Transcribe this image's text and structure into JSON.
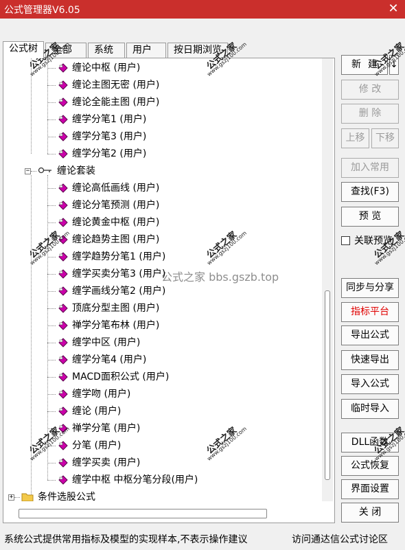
{
  "window": {
    "title": "公式管理器V6.05",
    "close_icon": "close-icon"
  },
  "tabs": [
    {
      "label": "公式树",
      "active": true
    },
    {
      "label": "全部",
      "active": false
    },
    {
      "label": "系统",
      "active": false
    },
    {
      "label": "用户",
      "active": false
    },
    {
      "label": "按日期浏览",
      "active": false
    }
  ],
  "tree": {
    "group1_items": [
      "缠论中枢 (用户)",
      "缠论主图无密 (用户)",
      "缠论全能主图 (用户)",
      "缠学分笔1 (用户)",
      "缠学分笔3 (用户)",
      "缠学分笔2 (用户)"
    ],
    "group2_label": "缠论套装",
    "group2_items": [
      "缠论高低画线 (用户)",
      "缠论分笔预测 (用户)",
      "缠论黄金中枢 (用户)",
      "缠论趋势主图 (用户)",
      "缠学趋势分笔1 (用户)",
      "缠学买卖分笔3 (用户)",
      "缠学画线分笔2 (用户)",
      "顶底分型主图 (用户)",
      "禅学分笔布林 (用户)",
      "缠学中区 (用户)",
      "缠学分笔4 (用户)",
      "MACD面积公式 (用户)",
      "缠学吻 (用户)",
      "缠论 (用户)",
      "禅学分笔 (用户)",
      "分笔 (用户)",
      "缠学买卖 (用户)",
      "缠学中枢  中枢分笔分段(用户)"
    ],
    "folder_label": "条件选股公式"
  },
  "buttons": {
    "new": "新建",
    "new_arrow": "↓",
    "modify": "修 改",
    "delete": "删 除",
    "move_up": "上移",
    "move_down": "下移",
    "add_common": "加入常用",
    "find": "查找(F3)",
    "preview": "预 览",
    "linked_preview": "关联预览",
    "sync_share": "同步与分享",
    "indicator_platform": "指标平台",
    "export_formula": "导出公式",
    "quick_export": "快速导出",
    "import_formula": "导入公式",
    "temp_import": "临时导入",
    "dll_func": "DLL函数",
    "formula_restore": "公式恢复",
    "ui_settings": "界面设置",
    "close": "关 闭"
  },
  "status": {
    "left": "系统公式提供常用指标及模型的实现样本,不表示操作建议",
    "right": "访问通达信公式讨论区"
  },
  "watermark": {
    "center": "公式之家 bbs.gszb.top",
    "stamp_title": "公式之家",
    "stamp_url": "www.gszj100.com"
  },
  "colors": {
    "titlebar": "#ca2f2c",
    "indicator_platform": "#e00000",
    "leaf_icon": "#cc00aa"
  }
}
